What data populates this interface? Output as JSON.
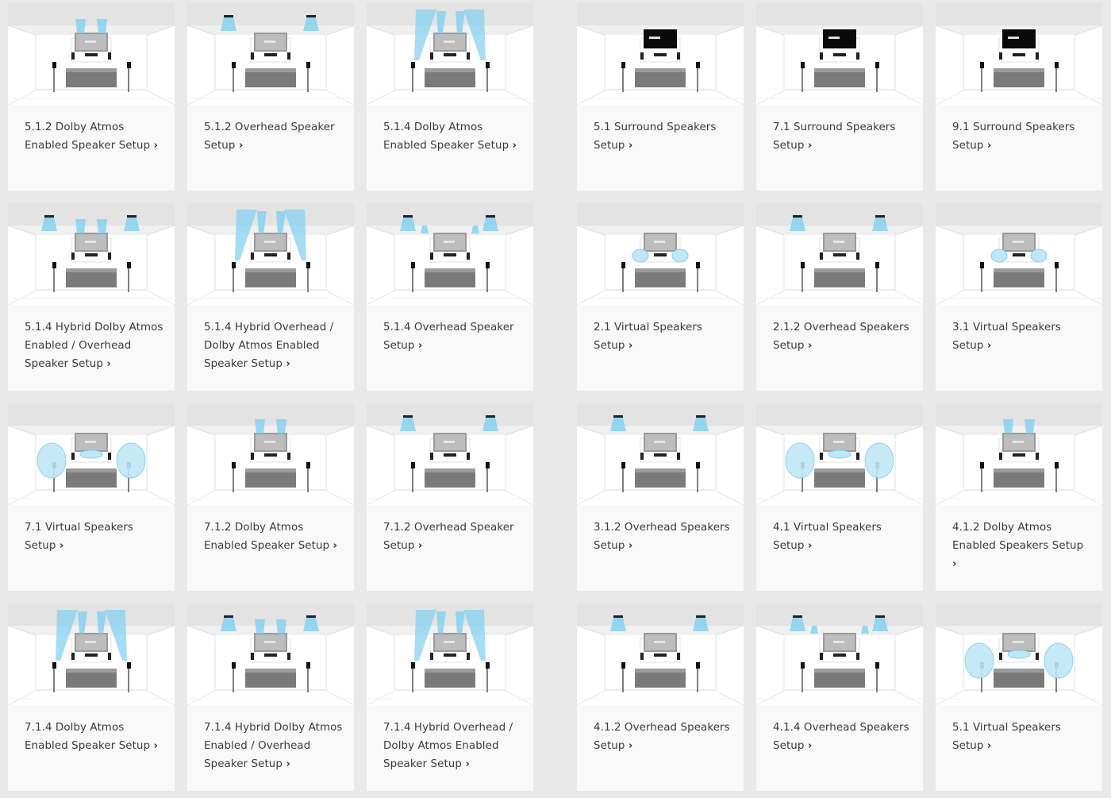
{
  "left_cards": [
    {
      "label": "5.1.2 Dolby Atmos Enabled Speaker Setup",
      "chevron": "›",
      "variant": "atmos-up-2"
    },
    {
      "label": "5.1.2 Overhead Speaker Setup",
      "chevron": "›",
      "variant": "ceiling-2"
    },
    {
      "label": "5.1.4 Dolby Atmos Enabled Speaker Setup",
      "chevron": "›",
      "variant": "atmos-up-4"
    },
    {
      "label": "5.1.4 Hybrid Dolby Atmos Enabled / Overhead Speaker Setup",
      "chevron": "›",
      "variant": "hybrid"
    },
    {
      "label": "5.1.4 Hybrid Overhead / Dolby Atmos Enabled Speaker Setup",
      "chevron": "›",
      "variant": "atmos-up-4"
    },
    {
      "label": "5.1.4 Overhead Speaker Setup",
      "chevron": "›",
      "variant": "ceiling-4"
    },
    {
      "label": "7.1 Virtual Speakers Setup",
      "chevron": "›",
      "variant": "virtual-big"
    },
    {
      "label": "7.1.2 Dolby Atmos Enabled Speaker Setup",
      "chevron": "›",
      "variant": "atmos-up-2"
    },
    {
      "label": "7.1.2 Overhead Speaker Setup",
      "chevron": "›",
      "variant": "ceiling-2"
    },
    {
      "label": "7.1.4 Dolby Atmos Enabled Speaker Setup",
      "chevron": "›",
      "variant": "atmos-up-4"
    },
    {
      "label": "7.1.4 Hybrid Dolby Atmos Enabled / Overhead Speaker Setup",
      "chevron": "›",
      "variant": "hybrid"
    },
    {
      "label": "7.1.4 Hybrid Overhead / Dolby Atmos Enabled Speaker Setup",
      "chevron": "›",
      "variant": "atmos-up-4"
    }
  ],
  "right_cards": [
    {
      "label": "5.1 Surround Speakers Setup",
      "chevron": "›",
      "variant": "black-tv"
    },
    {
      "label": "7.1 Surround Speakers Setup",
      "chevron": "›",
      "variant": "black-tv"
    },
    {
      "label": "9.1 Surround Speakers Setup",
      "chevron": "›",
      "variant": "black-tv"
    },
    {
      "label": "2.1 Virtual Speakers Setup",
      "chevron": "›",
      "variant": "virtual-small"
    },
    {
      "label": "2.1.2 Overhead Speakers Setup",
      "chevron": "›",
      "variant": "ceiling-2"
    },
    {
      "label": "3.1 Virtual Speakers Setup",
      "chevron": "›",
      "variant": "virtual-small"
    },
    {
      "label": "3.1.2 Overhead Speakers Setup",
      "chevron": "›",
      "variant": "ceiling-2"
    },
    {
      "label": "4.1 Virtual Speakers Setup",
      "chevron": "›",
      "variant": "virtual-big"
    },
    {
      "label": "4.1.2 Dolby Atmos Enabled Speakers Setup",
      "chevron": "›",
      "variant": "atmos-up-2"
    },
    {
      "label": "4.1.2 Overhead Speakers Setup",
      "chevron": "›",
      "variant": "ceiling-2"
    },
    {
      "label": "4.1.4 Overhead Speakers Setup",
      "chevron": "›",
      "variant": "ceiling-4"
    },
    {
      "label": "5.1 Virtual Speakers Setup",
      "chevron": "›",
      "variant": "virtual-big"
    }
  ],
  "colors": {
    "beam": "#7fd0f0",
    "beam_light": "#bfe7f7",
    "tv_screen": "#bdbdbd",
    "tv_black": "#0a0a0a",
    "couch": "#7a7a7a"
  }
}
